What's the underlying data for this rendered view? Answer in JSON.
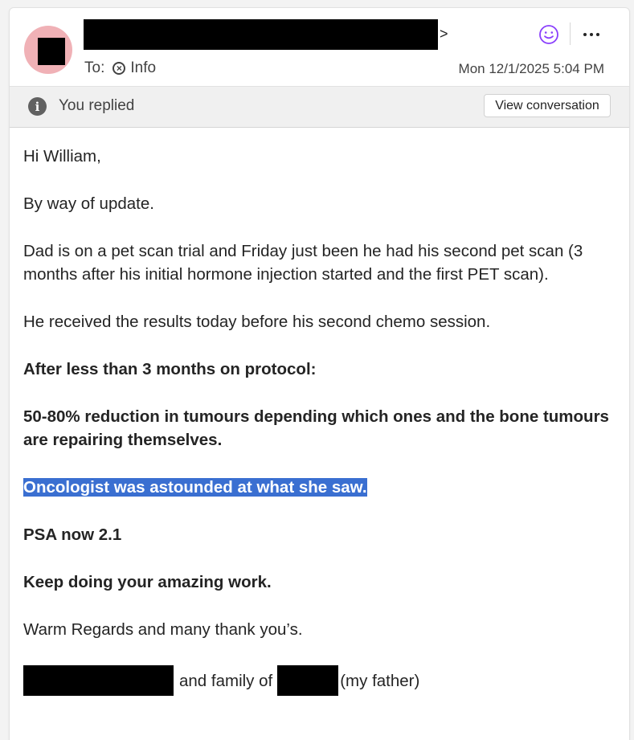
{
  "header": {
    "sender_suffix": ">",
    "to_label": "To:",
    "recipient": "Info",
    "timestamp": "Mon 12/1/2025 5:04 PM",
    "emoji_glyph": "☺",
    "more_glyph": "···"
  },
  "infobar": {
    "text": "You replied",
    "button_label": "View conversation"
  },
  "message": {
    "greeting": "Hi William,",
    "line_update": "By way of update.",
    "line_scan": "Dad is on a pet scan trial and Friday just been he had his second pet scan (3 months after his initial hormone injection started and the first PET scan).",
    "line_results": "He received the results today before his second chemo session.",
    "line_protocol": "After less than 3 months on protocol:",
    "line_reduction": "50-80% reduction in tumours depending which ones and the bone tumours are repairing themselves.",
    "line_oncologist": "Oncologist was astounded at what she saw.",
    "line_psa": "PSA now 2.1",
    "line_keep": "Keep doing your amazing work.",
    "line_regards": "Warm Regards and many thank you’s.",
    "sig_middle": "and family of",
    "sig_end": "(my father)"
  },
  "colors": {
    "avatar_bg": "#f0b1b6",
    "highlight_bg": "#3a6fd1",
    "emoji_icon": "#8a3ffc"
  },
  "icons": {
    "emoji": "smiley-face-icon",
    "more": "more-options-icon",
    "info": "info-icon",
    "recipient": "remove-recipient-icon"
  }
}
